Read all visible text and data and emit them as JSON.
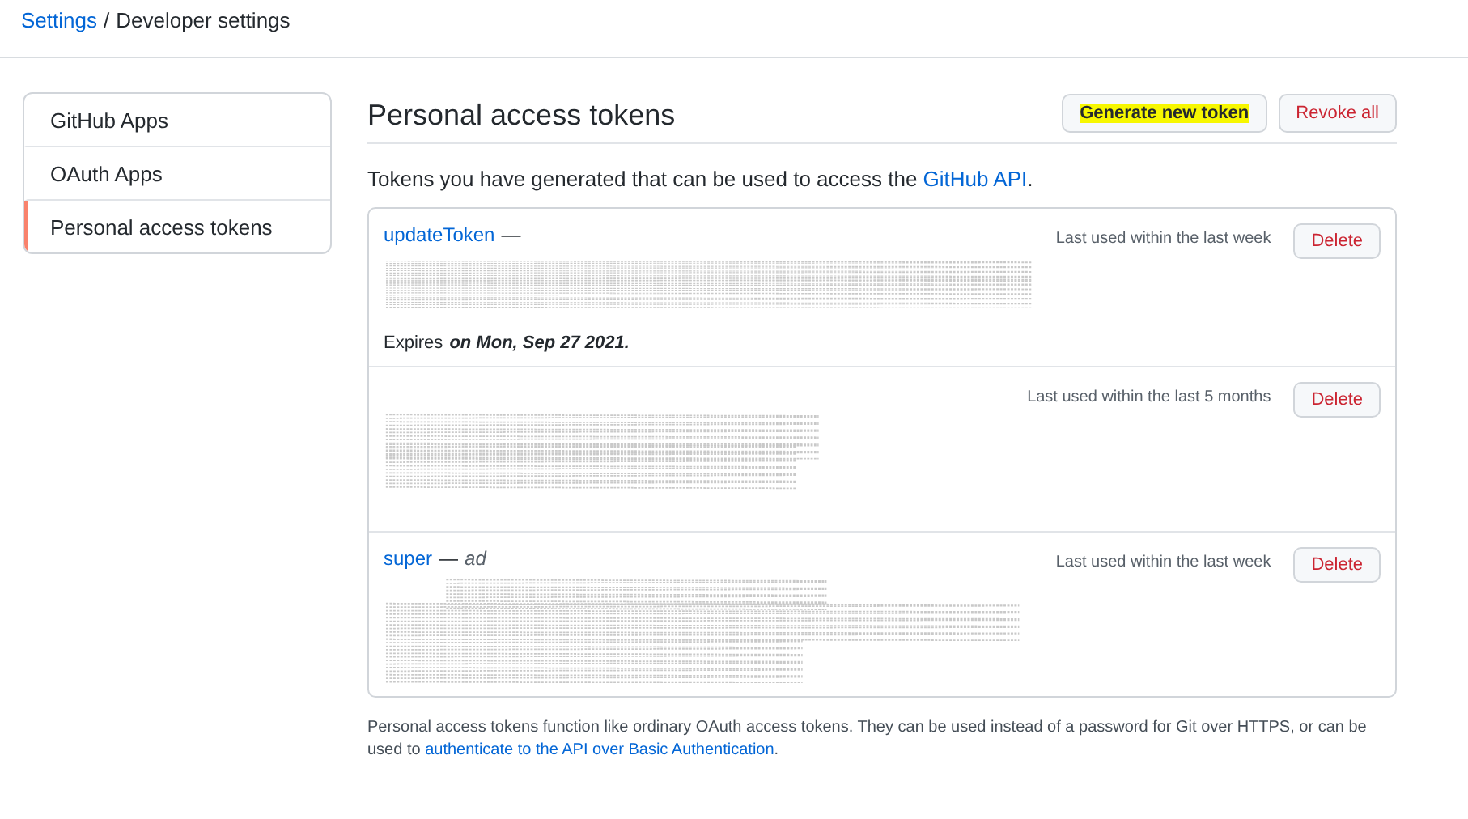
{
  "breadcrumb": {
    "parent": "Settings",
    "separator": "/",
    "current": "Developer settings"
  },
  "sidebar": {
    "items": [
      {
        "label": "GitHub Apps",
        "selected": false
      },
      {
        "label": "OAuth Apps",
        "selected": false
      },
      {
        "label": "Personal access tokens",
        "selected": true
      }
    ]
  },
  "header": {
    "title": "Personal access tokens",
    "buttons": [
      {
        "label": "Generate new token",
        "kind": "highlighted"
      },
      {
        "label": "Revoke all",
        "kind": "danger"
      }
    ]
  },
  "intro": {
    "text": "Tokens you have generated that can be used to access the",
    "link": "GitHub API",
    "end": "."
  },
  "tokens": [
    {
      "name": "updateToken",
      "dash": "—",
      "last_used": "Last used within the last week",
      "delete": "Delete",
      "expires_label": "Expires",
      "expires_date": "on Mon, Sep 27 2021."
    },
    {
      "last_used": "Last used within the last 5 months",
      "delete": "Delete"
    },
    {
      "name": "super",
      "dash": "—",
      "scope": "ad",
      "last_used": "Last used within the last week",
      "delete": "Delete"
    }
  ],
  "footer": {
    "text": "Personal access tokens function like ordinary OAuth access tokens. They can be used instead of a password for Git over HTTPS, or can be used to",
    "link": "authenticate to the API over Basic Authentication",
    "end": "."
  }
}
